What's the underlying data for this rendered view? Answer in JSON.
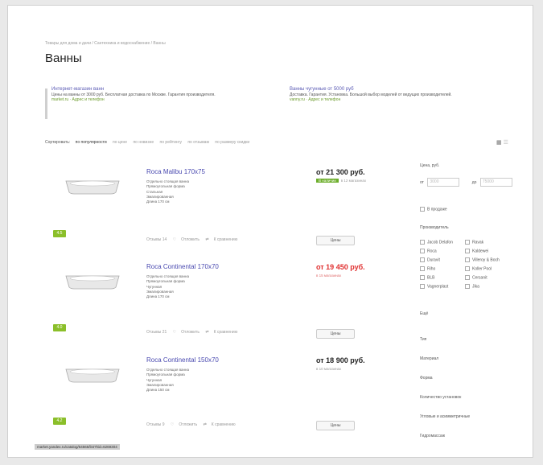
{
  "breadcrumb": "Товары для дома и дачи / Сантехника и водоснабжение / Ванны",
  "page_title": "Ванны",
  "ads": [
    {
      "title": "Интернет-магазин ванн",
      "text": "Цены на ванны от 3000 руб. Бесплатная доставка по Москве. Гарантия производителя.",
      "url": "market.ru · Адрес и телефон"
    },
    {
      "title": "Ванны чугунные от 5000 руб",
      "text": "Доставка. Гарантия. Установка. Большой выбор моделей от ведущих производителей.",
      "url": "vanny.ru · Адрес и телефон"
    }
  ],
  "sort": {
    "label": "Сортировать:",
    "options": [
      "по популярности",
      "по цене",
      "по новизне",
      "по рейтингу",
      "по отзывам",
      "по размеру скидки"
    ]
  },
  "products": [
    {
      "name": "Roca Malibu 170x75",
      "specs": [
        "Отдельно стоящая ванна",
        "Прямоугольная форма",
        "Стальная",
        "Эмалированная",
        "Длина 170 см"
      ],
      "rating": "4.5",
      "price": "от 21 300 руб.",
      "price_red": false,
      "stock_badge": "В наличии",
      "sub": "в 12 магазинах",
      "actions": [
        "Отзывы 14",
        "Отложить",
        "К сравнению"
      ],
      "button": "Цены"
    },
    {
      "name": "Roca Continental 170x70",
      "specs": [
        "Отдельно стоящая ванна",
        "Прямоугольная форма",
        "Чугунная",
        "Эмалированная",
        "Длина 170 см"
      ],
      "rating": "4.0",
      "price": "от 19 450 руб.",
      "price_red": true,
      "stock_badge": "",
      "sub": "в 15 магазинах",
      "actions": [
        "Отзывы 21",
        "Отложить",
        "К сравнению"
      ],
      "button": "Цены"
    },
    {
      "name": "Roca Continental 150x70",
      "specs": [
        "Отдельно стоящая ванна",
        "Прямоугольная форма",
        "Чугунная",
        "Эмалированная",
        "Длина 150 см"
      ],
      "rating": "4.2",
      "price": "от 18 900 руб.",
      "price_red": false,
      "stock_badge": "",
      "sub": "в 10 магазинах",
      "actions": [
        "Отзывы 9",
        "Отложить",
        "К сравнению"
      ],
      "button": "Цены"
    }
  ],
  "filter": {
    "price_label": "Цена, руб.",
    "from_label": "от",
    "to_label": "до",
    "from_placeholder": "3000",
    "to_placeholder": "75000",
    "in_stock": "В продаже",
    "maker_label": "Производитель",
    "makers": [
      "Jacob Delafon",
      "Ravak",
      "Roca",
      "Kaldewei",
      "Duravit",
      "Villeroy & Boch",
      "Riho",
      "Koller Pool",
      "BLB",
      "Cersanit",
      "Vagnerplast",
      "Jika"
    ],
    "sections": [
      "Ещё",
      "Тип",
      "Материал",
      "Форма",
      "Количество установок",
      "Угловые и асимметричные",
      "Гидромассаж"
    ]
  },
  "status_url": "market.yandex.ru/catalog/54565/list?hid=6269304"
}
